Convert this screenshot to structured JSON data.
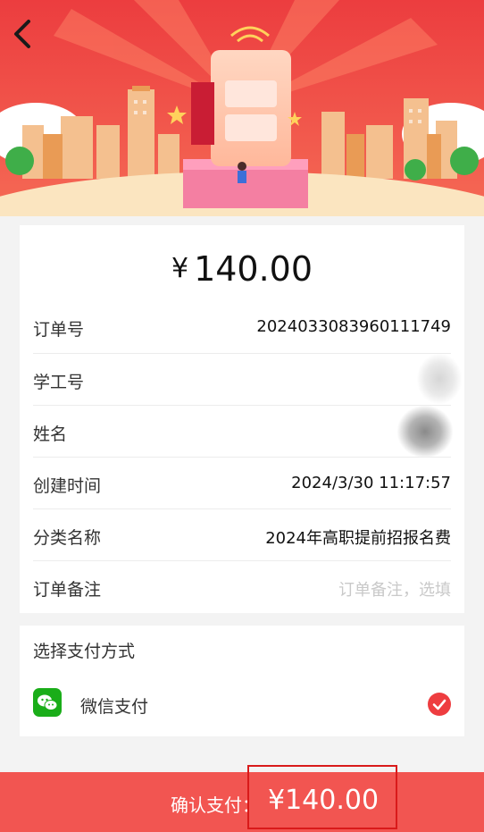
{
  "header": {
    "back_icon": "chevron-left-icon"
  },
  "banner": {
    "image": "phone-payment-city-illustration"
  },
  "amount": {
    "currency": "¥",
    "value": "140.00"
  },
  "order": [
    {
      "label": "订单号",
      "value": "2024033083960111749"
    },
    {
      "label": "学工号",
      "value": ""
    },
    {
      "label": "姓名",
      "value": ""
    },
    {
      "label": "创建时间",
      "value": "2024/3/30 11:17:57"
    },
    {
      "label": "分类名称",
      "value": "2024年高职提前招报名费"
    },
    {
      "label": "订单备注",
      "value": "",
      "placeholder": "订单备注，选填"
    }
  ],
  "payment": {
    "title": "选择支付方式",
    "method": "微信支付",
    "icon": "wechat-icon",
    "selected": true
  },
  "footer": {
    "label": "确认支付：",
    "amount": "¥140.00"
  },
  "colors": {
    "primary_red": "#f25551",
    "wechat_green": "#1aad19",
    "check_red": "#ee3d40"
  }
}
